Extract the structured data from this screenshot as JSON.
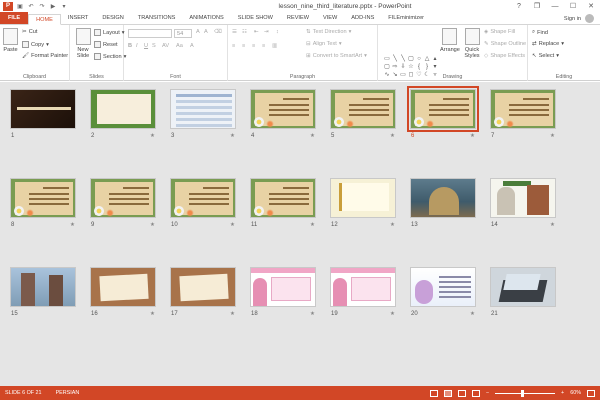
{
  "app": {
    "title": "lesson_nine_third_literature.pptx - PowerPoint",
    "signin": "Sign in"
  },
  "qat": {
    "app_icon": "P",
    "save_icon": "save-icon",
    "undo_icon": "undo-icon",
    "redo_icon": "redo-icon",
    "start_icon": "start-from-beginning-icon",
    "customize_icon": "customize-icon"
  },
  "window": {
    "help": "?",
    "restore": "❐",
    "minimize": "—",
    "maximize": "☐",
    "close": "✕"
  },
  "tabs": [
    "FILE",
    "HOME",
    "INSERT",
    "DESIGN",
    "TRANSITIONS",
    "ANIMATIONS",
    "SLIDE SHOW",
    "REVIEW",
    "VIEW",
    "ADD-INS",
    "FILEminimizer"
  ],
  "ribbon": {
    "clipboard": {
      "label": "Clipboard",
      "paste": "Paste",
      "cut": "Cut",
      "copy": "Copy",
      "format_painter": "Format Painter"
    },
    "slides": {
      "label": "Slides",
      "new_slide": "New Slide",
      "layout": "Layout",
      "reset": "Reset",
      "section": "Section"
    },
    "font": {
      "label": "Font",
      "size": "54"
    },
    "paragraph": {
      "label": "Paragraph",
      "text_direction": "Text Direction",
      "align_text": "Align Text",
      "convert": "Convert to SmartArt"
    },
    "drawing": {
      "label": "Drawing",
      "arrange": "Arrange",
      "quick_styles": "Quick Styles",
      "shape_fill": "Shape Fill",
      "shape_outline": "Shape Outline",
      "shape_effects": "Shape Effects"
    },
    "editing": {
      "label": "Editing",
      "find": "Find",
      "replace": "Replace",
      "select": "Select"
    }
  },
  "slides": [
    {
      "num": "1",
      "type": "dark",
      "star": false
    },
    {
      "num": "2",
      "type": "frame",
      "star": true
    },
    {
      "num": "3",
      "type": "table",
      "star": true
    },
    {
      "num": "4",
      "type": "scroll",
      "star": true
    },
    {
      "num": "5",
      "type": "scroll",
      "star": true
    },
    {
      "num": "6",
      "type": "scroll",
      "star": true,
      "selected": true
    },
    {
      "num": "7",
      "type": "scroll",
      "star": true
    },
    {
      "num": "8",
      "type": "scroll",
      "star": true
    },
    {
      "num": "9",
      "type": "scroll",
      "star": true
    },
    {
      "num": "10",
      "type": "scroll",
      "star": true
    },
    {
      "num": "11",
      "type": "scroll",
      "star": true
    },
    {
      "num": "12",
      "type": "yellow",
      "star": true
    },
    {
      "num": "13",
      "type": "photo1",
      "star": false
    },
    {
      "num": "14",
      "type": "portrait",
      "star": true
    },
    {
      "num": "15",
      "type": "tomb",
      "star": false
    },
    {
      "num": "16",
      "type": "wood",
      "star": true
    },
    {
      "num": "17",
      "type": "wood",
      "star": true
    },
    {
      "num": "18",
      "type": "pink",
      "star": true
    },
    {
      "num": "19",
      "type": "pink",
      "star": true
    },
    {
      "num": "20",
      "type": "grad",
      "star": true
    },
    {
      "num": "21",
      "type": "laptop",
      "star": false
    }
  ],
  "star_glyph": "★",
  "status": {
    "slide": "SLIDE 6 OF 21",
    "language": "PERSIAN",
    "zoom": "60%",
    "zoom_minus": "−",
    "zoom_plus": "+"
  }
}
